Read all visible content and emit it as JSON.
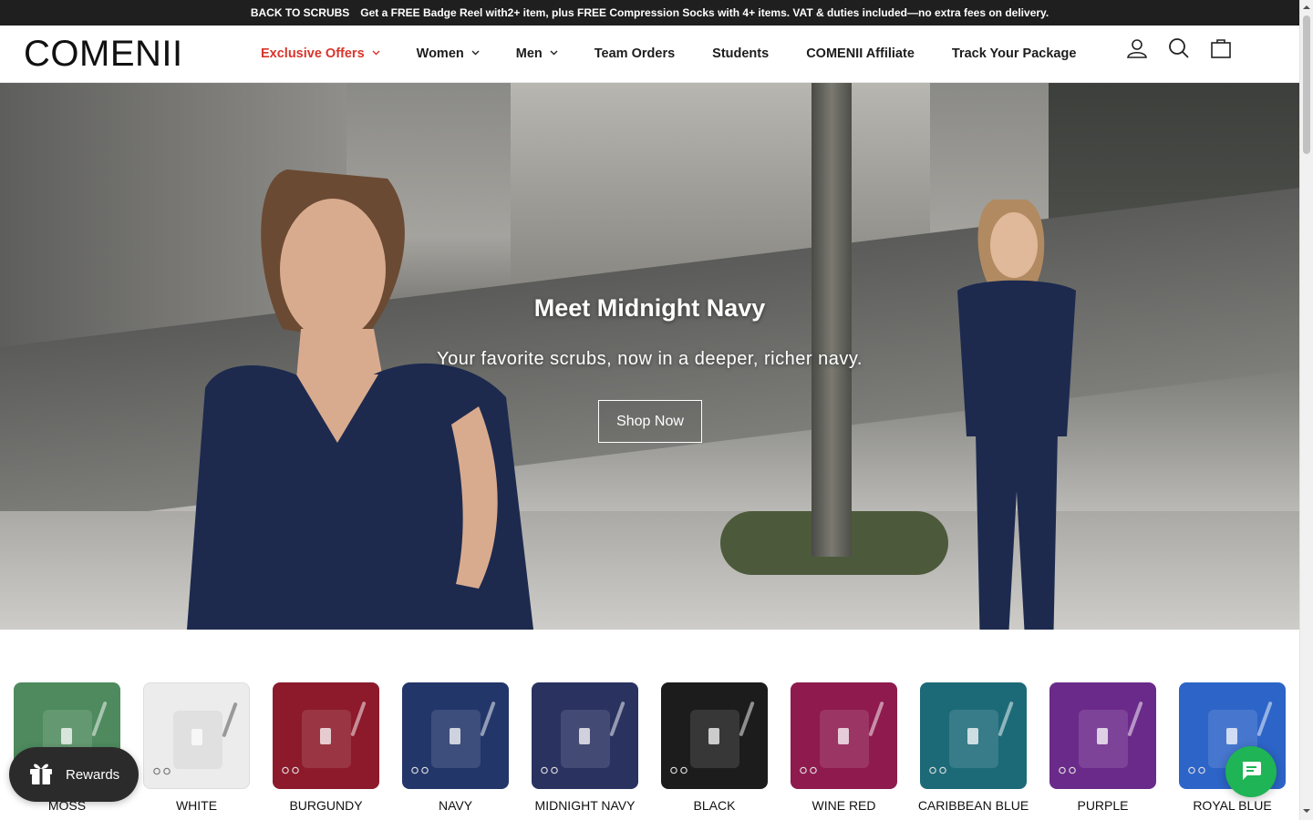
{
  "announcement": {
    "link": "BACK TO SCRUBS",
    "text": "Get a FREE Badge Reel with2+ item, plus FREE Compression Socks with 4+ items. VAT & duties included—no extra fees on delivery."
  },
  "header": {
    "logo": "COMENII",
    "nav": [
      {
        "label": "Exclusive Offers",
        "dropdown": true,
        "accent": true
      },
      {
        "label": "Women",
        "dropdown": true
      },
      {
        "label": "Men",
        "dropdown": true
      },
      {
        "label": "Team Orders",
        "dropdown": false
      },
      {
        "label": "Students",
        "dropdown": false
      },
      {
        "label": "COMENII Affiliate",
        "dropdown": false
      },
      {
        "label": "Track Your Package",
        "dropdown": false
      }
    ],
    "icons": [
      "account-icon",
      "search-icon",
      "cart-icon"
    ],
    "accent_color": "#d9342b"
  },
  "hero": {
    "title": "Meet Midnight Navy",
    "subtitle": "Your favorite scrubs, now in a deeper, richer navy.",
    "button": "Shop Now"
  },
  "colors": [
    {
      "label": "MOSS",
      "color": "#4e8a5e"
    },
    {
      "label": "WHITE",
      "color": "#ececec"
    },
    {
      "label": "BURGUNDY",
      "color": "#8c1a2b"
    },
    {
      "label": "NAVY",
      "color": "#23366a"
    },
    {
      "label": "MIDNIGHT NAVY",
      "color": "#2a3260"
    },
    {
      "label": "BLACK",
      "color": "#1c1c1c"
    },
    {
      "label": "WINE RED",
      "color": "#8e1a4e"
    },
    {
      "label": "CARIBBEAN BLUE",
      "color": "#1c6a78"
    },
    {
      "label": "PURPLE",
      "color": "#6a2a8a"
    },
    {
      "label": "ROYAL BLUE",
      "color": "#2d64c8"
    }
  ],
  "widgets": {
    "rewards_label": "Rewards",
    "chat_color": "#1fb455"
  }
}
